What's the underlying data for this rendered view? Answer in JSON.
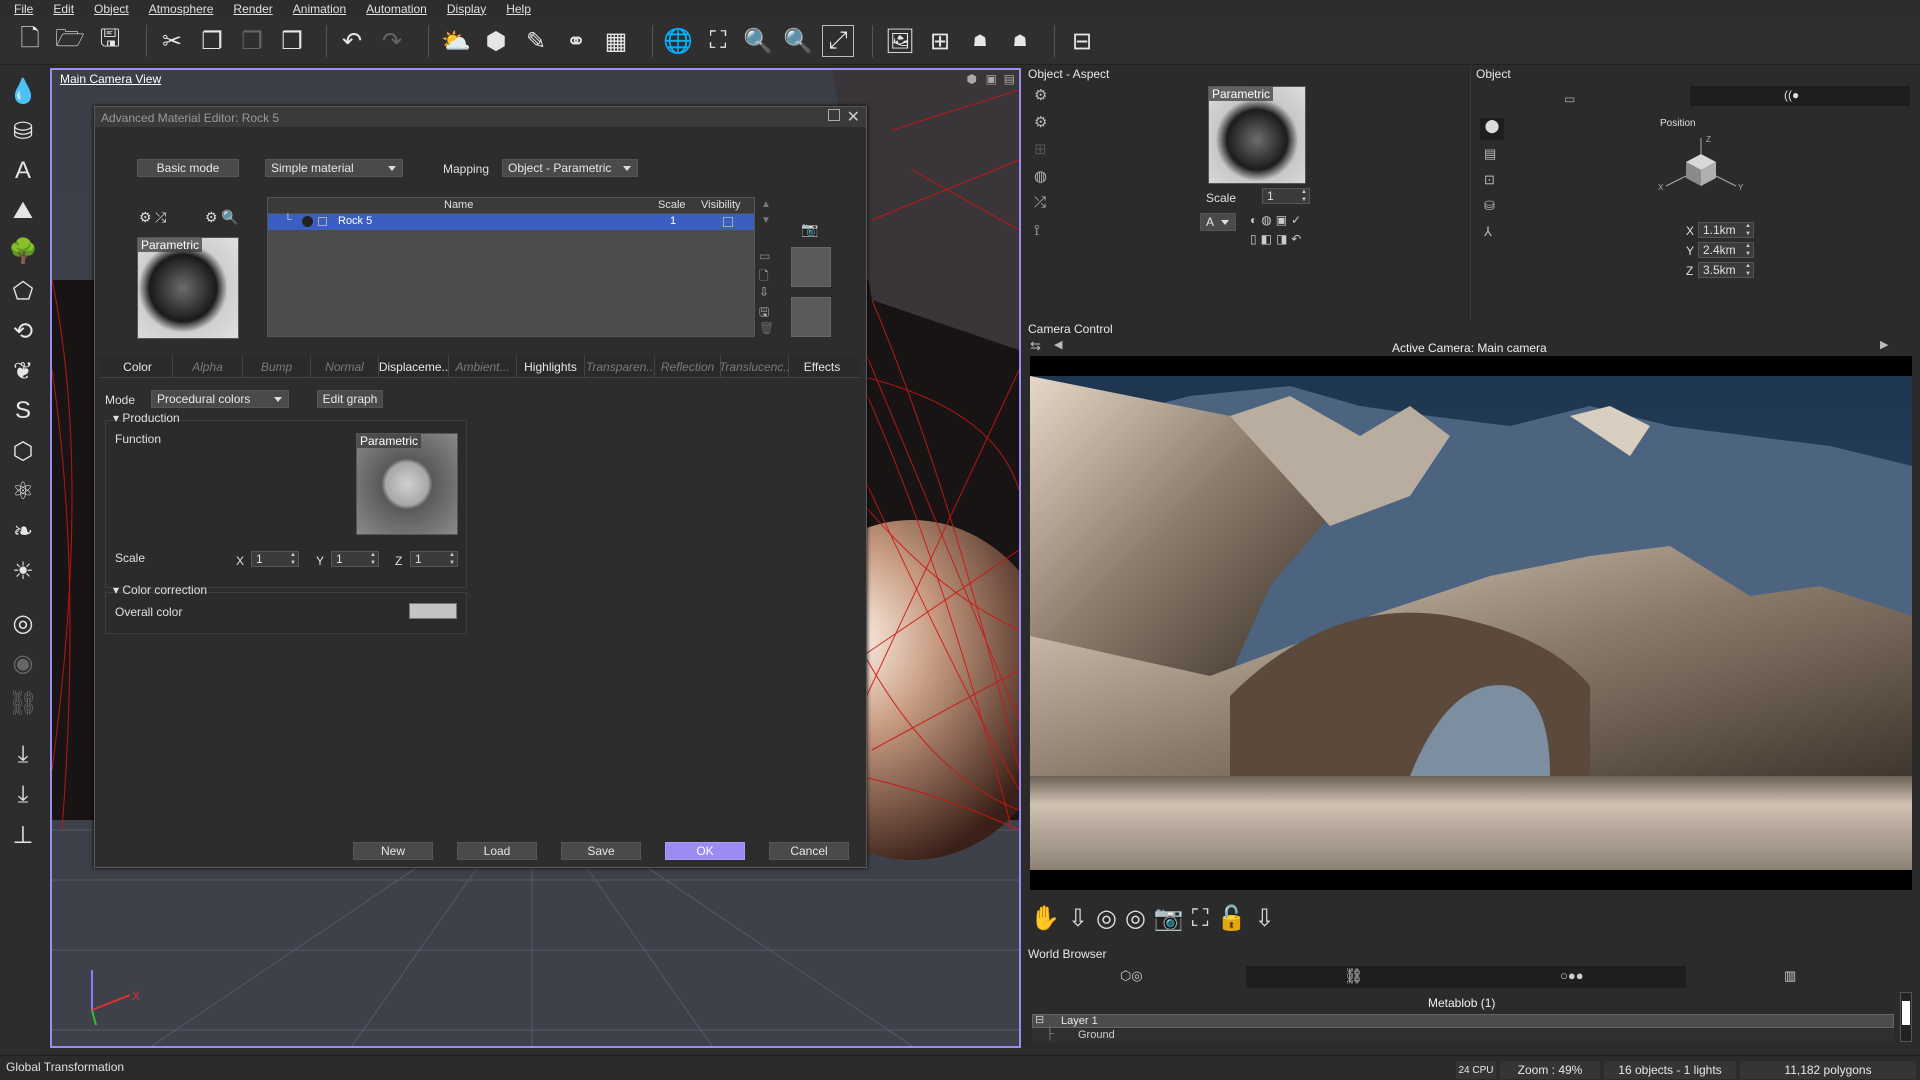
{
  "menu": [
    "File",
    "Edit",
    "Object",
    "Atmosphere",
    "Render",
    "Animation",
    "Automation",
    "Display",
    "Help"
  ],
  "viewport": {
    "title": "Main Camera View"
  },
  "editor": {
    "title": "Advanced Material Editor: Rock 5",
    "basic_mode": "Basic mode",
    "material_type": "Simple material",
    "mapping_label": "Mapping",
    "mapping_value": "Object - Parametric",
    "preview_caption": "Parametric",
    "table": {
      "headers": [
        "Name",
        "Scale",
        "Visibility"
      ],
      "rows": [
        {
          "name": "Rock 5",
          "scale": "1"
        }
      ]
    },
    "tabs": [
      {
        "label": "Color",
        "enabled": true
      },
      {
        "label": "Alpha",
        "enabled": false
      },
      {
        "label": "Bump",
        "enabled": false
      },
      {
        "label": "Normal",
        "enabled": false
      },
      {
        "label": "Displaceme..",
        "enabled": true
      },
      {
        "label": "Ambient...",
        "enabled": false
      },
      {
        "label": "Highlights",
        "enabled": true
      },
      {
        "label": "Transparen..",
        "enabled": false
      },
      {
        "label": "Reflection",
        "enabled": false
      },
      {
        "label": "Translucenc..",
        "enabled": false
      },
      {
        "label": "Effects",
        "enabled": true
      }
    ],
    "mode_label": "Mode",
    "mode_value": "Procedural colors",
    "edit_graph": "Edit graph",
    "production": {
      "header": "Production",
      "function_label": "Function",
      "function_caption": "Parametric",
      "scale_label": "Scale",
      "x_label": "X",
      "x": "1",
      "y_label": "Y",
      "y": "1",
      "z_label": "Z",
      "z": "1"
    },
    "color_correction": {
      "header": "Color correction",
      "overall_label": "Overall color",
      "overall_color": "#c4c4c4"
    },
    "buttons": {
      "new": "New",
      "load": "Load",
      "save": "Save",
      "ok": "OK",
      "cancel": "Cancel"
    }
  },
  "aspect": {
    "title": "Object - Aspect",
    "caption": "Parametric",
    "scale_label": "Scale",
    "scale": "1",
    "letter": "A"
  },
  "object": {
    "title": "Object",
    "position_label": "Position",
    "x_label": "X",
    "x": "1.1km",
    "y_label": "Y",
    "y": "2.4km",
    "z_label": "Z",
    "z": "3.5km"
  },
  "camera": {
    "title": "Camera Control",
    "active": "Active Camera: Main camera"
  },
  "world": {
    "title": "World Browser",
    "metablob": "Metablob (1)",
    "layer": "Layer 1",
    "ground": "Ground"
  },
  "status": {
    "left": "Global Transformation",
    "cpu": "24 CPU",
    "zoom": "Zoom : 49%",
    "objects": "16 objects - 1 lights",
    "polygons": "11,182 polygons"
  },
  "colors": {
    "accent": "#9b8cf3",
    "selection": "#3b5fc0",
    "wire": "#cc1515"
  }
}
